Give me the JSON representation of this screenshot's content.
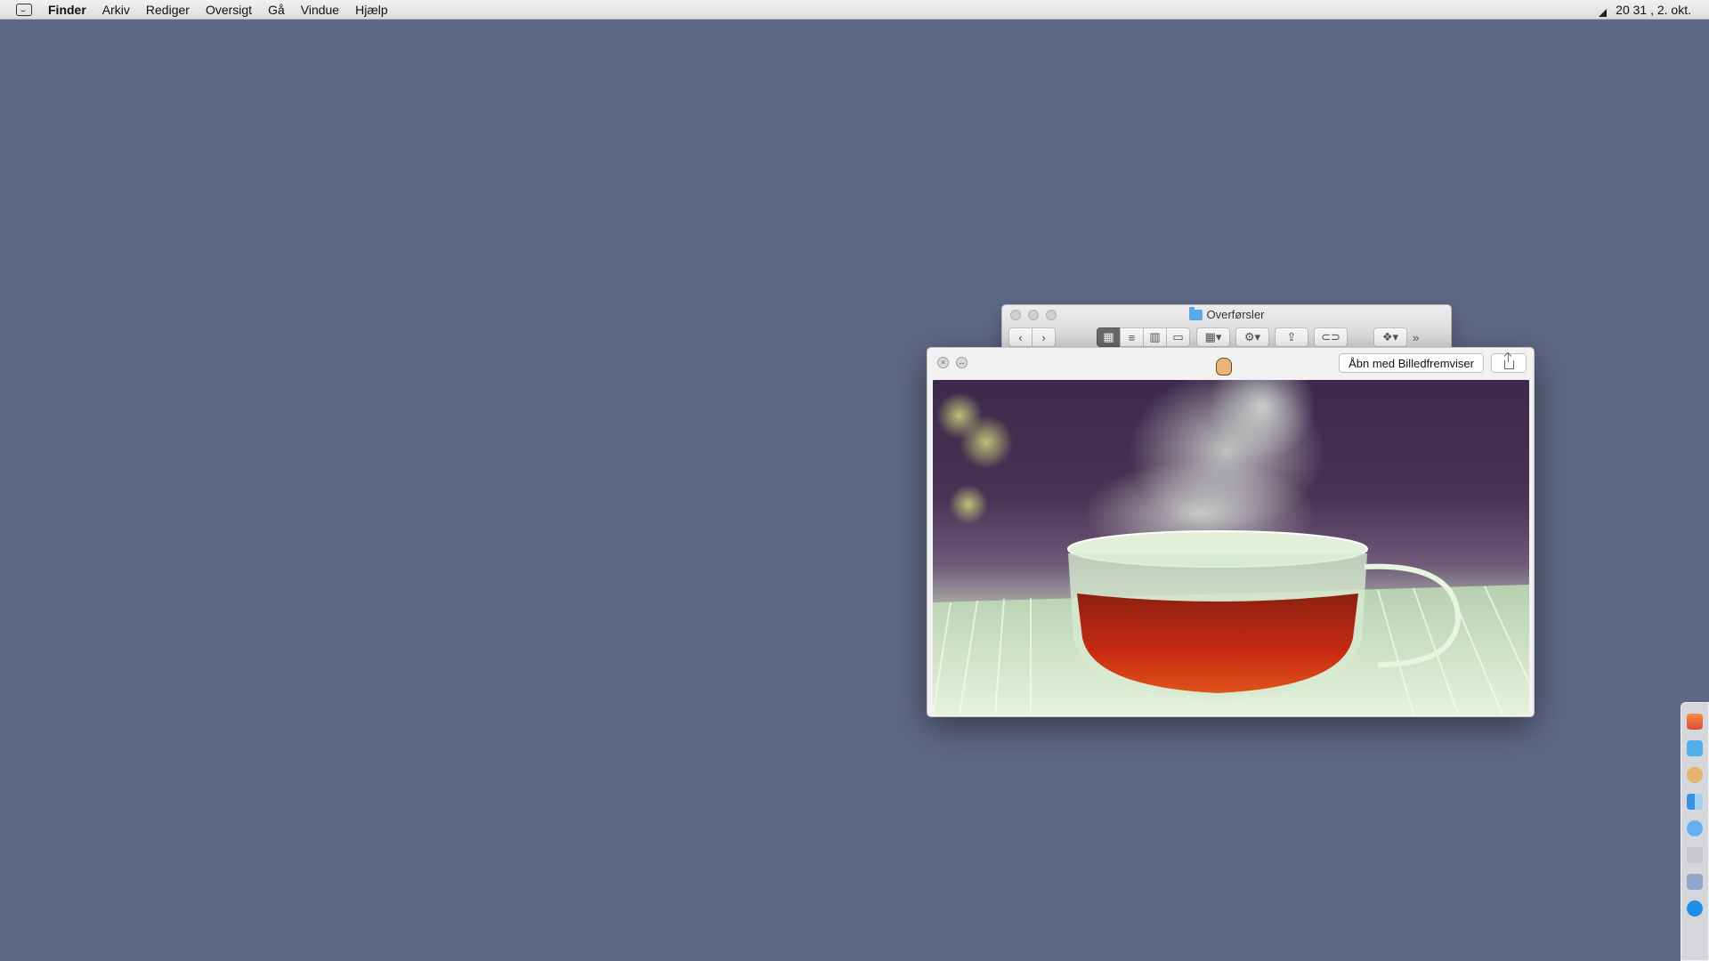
{
  "menubar": {
    "app_name": "Finder",
    "items": [
      "Arkiv",
      "Rediger",
      "Oversigt",
      "Gå",
      "Vindue",
      "Hjælp"
    ],
    "clock": "20 31 , 2. okt."
  },
  "finder_window": {
    "title": "Overførsler"
  },
  "quicklook": {
    "open_button_label": "Åbn med Billedfremviser",
    "image_description_icon": "tea-cup-photo"
  },
  "colors": {
    "desktop": "#5f6886",
    "tea": "#c42d12",
    "steam": "#dfeed6"
  },
  "dock": {
    "icons": [
      "apple-icon",
      "folder-icon",
      "hand-icon",
      "finder-icon",
      "messages-icon",
      "contacts-icon",
      "photos-icon",
      "safari-icon"
    ]
  }
}
